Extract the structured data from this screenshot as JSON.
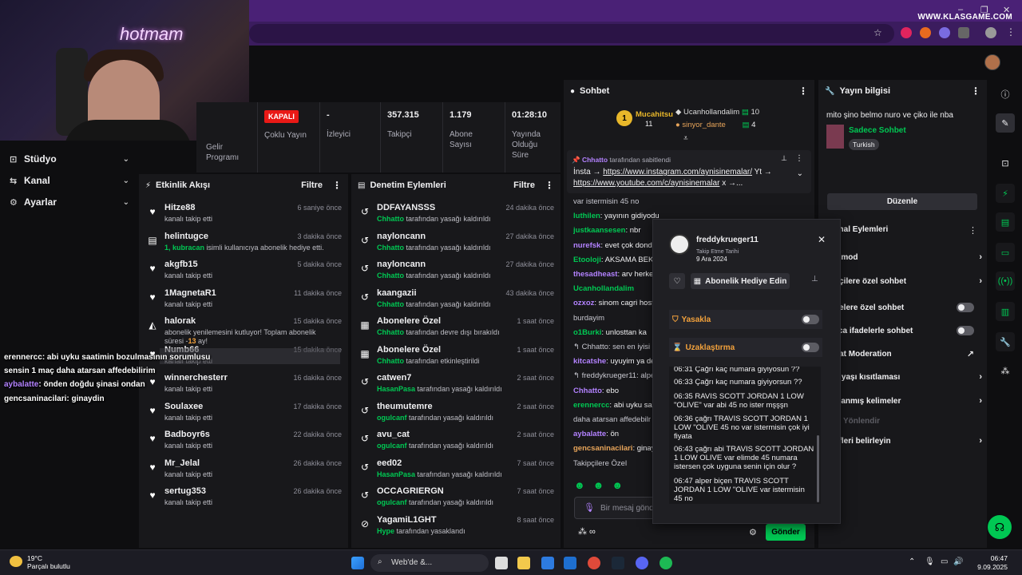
{
  "browser": {
    "watermark": "WWW.KLASGAME.COM"
  },
  "webcam": {
    "neon_sign": "hotmam"
  },
  "nav": [
    {
      "label": "Stüdyo"
    },
    {
      "label": "Kanal"
    },
    {
      "label": "Ayarlar"
    }
  ],
  "stats": {
    "offline_badge": "KAPALI",
    "multistream": "Çoklu Yayın",
    "viewers_value": "-",
    "viewers_label": "İzleyici",
    "followers_value": "357.315",
    "followers_label": "Takipçi",
    "subs_value": "1.179",
    "subs_label": "Abone Sayısı",
    "uptime_value": "01:28:10",
    "uptime_label": "Yayında Olduğu Süre",
    "revenue_label": "Gelir Programı"
  },
  "activity": {
    "title": "Etkinlik Akışı",
    "filter": "Filtre",
    "items": [
      {
        "name": "Hitze88",
        "sub": "kanalı takip etti",
        "time": "6 saniye önce",
        "icon": "♥"
      },
      {
        "name": "helintugce",
        "sub_green": "1, kubracan",
        "sub": " isimli kullanıcıya abonelik hediye etti.",
        "time": "3 dakika önce",
        "icon": "▤"
      },
      {
        "name": "akgfb15",
        "sub": "kanalı takip etti",
        "time": "5 dakika önce",
        "icon": "♥"
      },
      {
        "name": "1MagnetaR1",
        "sub": "kanalı takip etti",
        "time": "11 dakika önce",
        "icon": "♥"
      },
      {
        "name": "halorak",
        "sub": "abonelik yenilemesini kutluyor! Toplam abonelik süresi -",
        "sub2": "13",
        "sub3": " ay!",
        "time": "15 dakika önce",
        "icon": "◭"
      },
      {
        "name": "Numb66",
        "sub": "kanalı takip etti",
        "time": "15 dakika önce",
        "icon": "♥"
      },
      {
        "name": "winnerchesterr",
        "sub": "kanalı takip etti",
        "time": "16 dakika önce",
        "icon": "♥"
      },
      {
        "name": "Soulaxee",
        "sub": "kanalı takip etti",
        "time": "17 dakika önce",
        "icon": "♥"
      },
      {
        "name": "Badboyr6s",
        "sub": "kanalı takip etti",
        "time": "22 dakika önce",
        "icon": "♥"
      },
      {
        "name": "Mr_Jelal",
        "sub": "kanalı takip etti",
        "time": "26 dakika önce",
        "icon": "♥"
      },
      {
        "name": "sertug353",
        "sub": "kanalı takip etti",
        "time": "26 dakika önce",
        "icon": "♥"
      }
    ]
  },
  "moderation": {
    "title": "Denetim Eylemleri",
    "filter": "Filtre",
    "items": [
      {
        "name": "DDFAYANSSS",
        "mod": "Chhatto",
        "action": " tarafından yasağı kaldırıldı",
        "time": "24 dakika önce",
        "icon": "↺"
      },
      {
        "name": "nayloncann",
        "mod": "Chhatto",
        "action": " tarafından yasağı kaldırıldı",
        "time": "27 dakika önce",
        "icon": "↺"
      },
      {
        "name": "nayloncann",
        "mod": "Chhatto",
        "action": " tarafından yasağı kaldırıldı",
        "time": "27 dakika önce",
        "icon": "↺"
      },
      {
        "name": "kaangazii",
        "mod": "Chhatto",
        "action": " tarafından yasağı kaldırıldı",
        "time": "43 dakika önce",
        "icon": "↺"
      },
      {
        "name": "Abonelere Özel",
        "mod": "Chhatto",
        "action": " tarafından devre dışı bırakıldı",
        "time": "1 saat önce",
        "icon": "▦"
      },
      {
        "name": "Abonelere Özel",
        "mod": "Chhatto",
        "action": " tarafından etkinleştirildi",
        "time": "1 saat önce",
        "icon": "▦"
      },
      {
        "name": "catwen7",
        "mod": "HasanPasa",
        "action": " tarafından yasağı kaldırıldı",
        "time": "2 saat önce",
        "icon": "↺"
      },
      {
        "name": "theumutemre",
        "mod": "ogulcanf",
        "action": " tarafından yasağı kaldırıldı",
        "time": "2 saat önce",
        "icon": "↺"
      },
      {
        "name": "avu_cat",
        "mod": "ogulcanf",
        "action": " tarafından yasağı kaldırıldı",
        "time": "2 saat önce",
        "icon": "↺"
      },
      {
        "name": "eed02",
        "mod": "HasanPasa",
        "action": " tarafından yasağı kaldırıldı",
        "time": "7 saat önce",
        "icon": "↺"
      },
      {
        "name": "OCCAGRIERGN",
        "mod": "ogulcanf",
        "action": " tarafından yasağı kaldırıldı",
        "time": "7 saat önce",
        "icon": "↺"
      },
      {
        "name": "YagamiL1GHT",
        "mod": "Hype",
        "action": " tarafından yasaklandı",
        "time": "8 saat önce",
        "icon": "⊘"
      }
    ]
  },
  "chat": {
    "title": "Sohbet",
    "top1_name": "Mucahitsu",
    "top1_count": "11",
    "top2_name": "Ucanhollandalim",
    "top2_count": "10",
    "top3_name": "sinyor_dante",
    "top3_count": "4",
    "pinned_by": "Chhatto",
    "pinned_suffix": " tarafından sabitlendi",
    "pinned_line1_pre": "İnsta → ",
    "pinned_line1_link": "https://www.instagram.com/aynisinemalar/",
    "pinned_line1_post": " Yt →",
    "pinned_line2_link": "https://www.youtube.com/c/aynisinemalar",
    "pinned_line2_post": " x →...",
    "lines": [
      {
        "user": "",
        "text": "var istermisin 45 no"
      },
      {
        "user": "luthilen",
        "text": ": yayının gidiyodu"
      },
      {
        "user": "justkaansesen",
        "text": ": nbr"
      },
      {
        "user": "nurefsk",
        "text": ": evet çok dondu"
      },
      {
        "user": "Etooloji",
        "text": ": AKSAMA BEKL"
      },
      {
        "user": "thesadheast",
        "text": ": arv herke"
      },
      {
        "user": "Ucanhollandalim",
        "text": ""
      },
      {
        "user": "ozxoz",
        "text": ": sinom cagri host"
      },
      {
        "user": "",
        "text": "burdayim"
      },
      {
        "user": "o1Burki",
        "text": ": unlosttan ka"
      },
      {
        "user": "",
        "text": "↰ Chhatto: sen en iyisi uy"
      },
      {
        "user": "kitcatshe",
        "text": ": uyuyim ya dedi"
      },
      {
        "user": "",
        "text": "↰ freddykrueger11: alpe"
      },
      {
        "user": "Chhatto",
        "text": ": ebo"
      },
      {
        "user": "erennercc",
        "text": ": abi uyku sa"
      },
      {
        "user": "",
        "text": "daha atarsan affedebilr"
      },
      {
        "user": "aybalatte",
        "text": ": ön"
      },
      {
        "user": "gencsaninacilari",
        "text": ": ginay"
      },
      {
        "user": "",
        "text": "Takipçilere Özel"
      }
    ],
    "input_placeholder": "Bir mesaj gönd",
    "send": "Gönder"
  },
  "usercard": {
    "name": "freddykrueger11",
    "follow_label": "Takip Etme Tarihi",
    "follow_date": "9 Ara 2024",
    "gift": "Abonelik Hediye Edin",
    "ban": "Yasakla",
    "timeout": "Uzaklaştırma",
    "messages": [
      {
        "time": "06:31",
        "text": "Çağrı kaç numara giyiyosun ??"
      },
      {
        "time": "06:33",
        "text": "Çağrı kaç numara giyiyorsun ??"
      },
      {
        "time": "06:35",
        "text": "RAVIS SCOTT JORDAN 1 LOW \"OLIVE\" var abi 45 no ister mşşşn"
      },
      {
        "time": "06:36",
        "text": "çağrı TRAVIS SCOTT JORDAN 1 LOW \"OLIVE 45 no var istermisin çok iyi fiyata"
      },
      {
        "time": "06:43",
        "text": "çağrı abi TRAVIS SCOTT JORDAN 1 LOW OLIVE var elimde 45 numara istersen çok uyguna senin için olur ?"
      },
      {
        "time": "06:47",
        "text": "alper biçen TRAVIS SCOTT JORDAN 1 LOW \"OLIVE var istermisin 45 no"
      }
    ]
  },
  "streaminfo": {
    "title": "Yayın bilgisi",
    "stream_title": "mito şino belmo nuro ve çiko ile nba",
    "category": "Sadece Sohbet",
    "language": "Turkish",
    "edit": "Düzenle"
  },
  "channel_actions": {
    "title": "anal Eylemleri",
    "items": [
      {
        "label": "ş mod",
        "type": "chev"
      },
      {
        "label": "pçilere özel sohbet",
        "type": "chev"
      },
      {
        "label": "nelere özel sohbet",
        "type": "toggle"
      },
      {
        "label": "zca ifadelerle sohbet",
        "type": "toggle"
      },
      {
        "label": "hat Moderation",
        "type": "ext"
      },
      {
        "label": "p yaşı kısıtlaması",
        "type": "chev"
      },
      {
        "label": "klanmış kelimeler",
        "type": "chev"
      },
      {
        "label": "ci Yönlendir",
        "type": "dim"
      },
      {
        "label": "efleri belirleyin",
        "type": "chev"
      }
    ]
  },
  "overlay_chat": [
    {
      "user": "erennercc",
      "text": ": abi uyku saatimin bozulmasının sorumlusu"
    },
    {
      "user": "",
      "text": "sensin 1 maç daha atarsan affedebilirim"
    },
    {
      "user": "aybalatte",
      "text": ": önden doğdu şinasi ondan"
    },
    {
      "user": "gencsaninacilari",
      "text": ": ginaydin"
    }
  ],
  "taskbar": {
    "temp": "19°C",
    "weather": "Parçalı bulutlu",
    "search": "Web'de &...",
    "time": "06:47",
    "date": "9.09.2025"
  },
  "colors": {
    "accent": "#00c853",
    "brand_purple": "#4a2176",
    "offline_red": "#e91916"
  }
}
